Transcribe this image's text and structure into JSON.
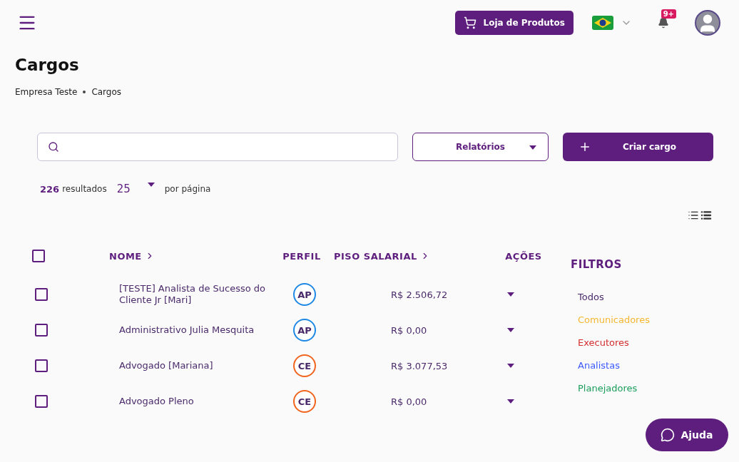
{
  "header": {
    "store_button": "Loja de Produtos",
    "notification_badge": "9+"
  },
  "page": {
    "title": "Cargos",
    "breadcrumb": [
      "Empresa Teste",
      "Cargos"
    ]
  },
  "toolbar": {
    "reports_button": "Relatórios",
    "create_button": "Criar cargo"
  },
  "results": {
    "count": "226",
    "count_label": "resultados",
    "per_page": "25",
    "per_page_label": "por página"
  },
  "table": {
    "select_all_checked": false,
    "columns": [
      {
        "label": "NOME",
        "sortable": true
      },
      {
        "label": "PERFIL",
        "sortable": false
      },
      {
        "label": "PISO SALARIAL",
        "sortable": true
      },
      {
        "label": "AÇÕES",
        "sortable": false
      }
    ],
    "rows": [
      {
        "checked": false,
        "name": "[TESTE] Analista de Sucesso do Cliente Jr [Mari]",
        "profile": "AP",
        "color": "#1e88e5",
        "salary": "R$ 2.506,72"
      },
      {
        "checked": false,
        "name": "Administrativo Julia Mesquita",
        "profile": "AP",
        "color": "#1e88e5",
        "salary": "R$ 0,00"
      },
      {
        "checked": false,
        "name": "Advogado [Mariana]",
        "profile": "CE",
        "color": "#f0641e",
        "salary": "R$ 3.077,53"
      },
      {
        "checked": false,
        "name": "Advogado Pleno",
        "profile": "CE",
        "color": "#f0641e",
        "salary": "R$ 0,00"
      }
    ]
  },
  "filters": {
    "title": "FILTROS",
    "items": [
      {
        "label": "Todos",
        "color": "#4a2a6a"
      },
      {
        "label": "Comunicadores",
        "color": "#f5b731"
      },
      {
        "label": "Executores",
        "color": "#d32f2f"
      },
      {
        "label": "Analistas",
        "color": "#3d5afe"
      },
      {
        "label": "Planejadores",
        "color": "#1a9e5c"
      }
    ]
  },
  "help_button": "Ajuda"
}
